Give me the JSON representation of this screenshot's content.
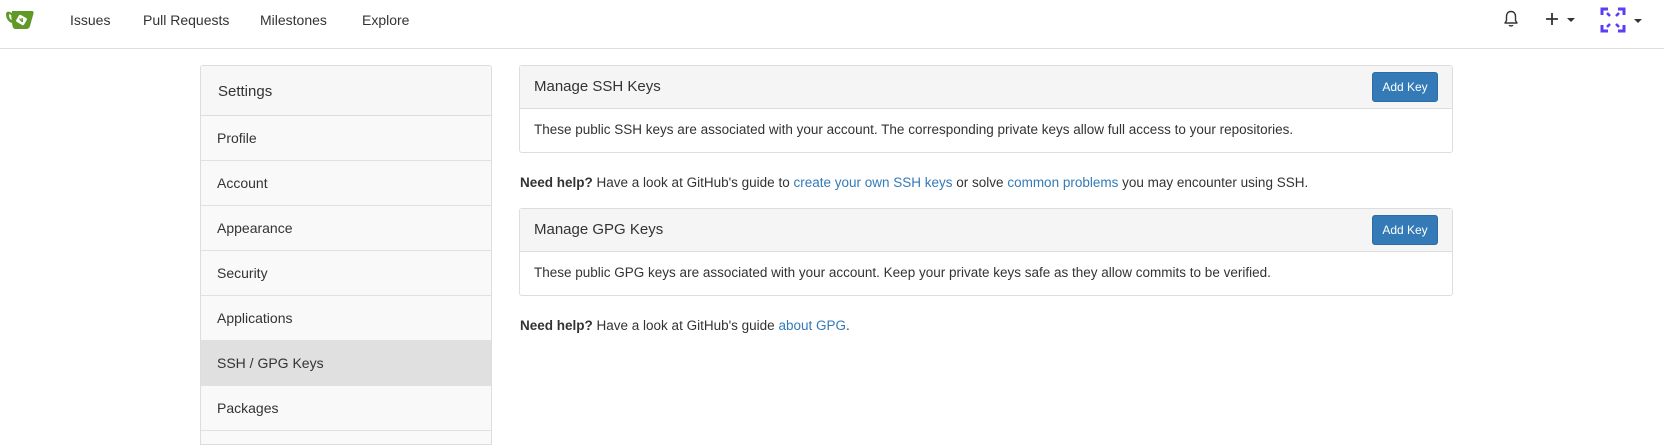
{
  "nav": {
    "items": [
      "Issues",
      "Pull Requests",
      "Milestones",
      "Explore"
    ],
    "logo_color": "#609926"
  },
  "sidebar": {
    "title": "Settings",
    "items": [
      {
        "label": "Profile"
      },
      {
        "label": "Account"
      },
      {
        "label": "Appearance"
      },
      {
        "label": "Security"
      },
      {
        "label": "Applications"
      },
      {
        "label": "SSH / GPG Keys"
      },
      {
        "label": "Packages"
      }
    ],
    "active_index": 5
  },
  "ssh": {
    "title": "Manage SSH Keys",
    "button": "Add Key",
    "description": "These public SSH keys are associated with your account. The corresponding private keys allow full access to your repositories.",
    "help_bold": "Need help?",
    "help_text_1": " Have a look at GitHub's guide to ",
    "help_link_1": "create your own SSH keys",
    "help_text_2": " or solve ",
    "help_link_2": "common problems",
    "help_text_3": " you may encounter using SSH."
  },
  "gpg": {
    "title": "Manage GPG Keys",
    "button": "Add Key",
    "description": "These public GPG keys are associated with your account. Keep your private keys safe as they allow commits to be verified.",
    "help_bold": "Need help?",
    "help_text_1": " Have a look at GitHub's guide ",
    "help_link_1": "about GPG",
    "help_text_2": "."
  },
  "colors": {
    "link": "#337ab7",
    "primary": "#337ab7",
    "avatar": "#5b3df5"
  }
}
